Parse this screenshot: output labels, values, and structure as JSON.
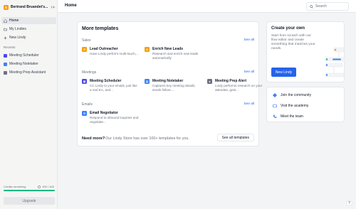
{
  "workspace": {
    "avatar_letter": "B",
    "name": "Bertrand Bruandet's..."
  },
  "topbar": {
    "title": "Home",
    "search_placeholder": "Search"
  },
  "nav": [
    {
      "label": "Home",
      "icon": "home-icon",
      "active": true
    },
    {
      "label": "My Lindies",
      "icon": "folder-icon",
      "active": false
    },
    {
      "label": "New Lindy",
      "icon": "plus-icon",
      "active": false
    }
  ],
  "recents": {
    "label": "Recents",
    "items": [
      {
        "label": "Meeting Scheduler",
        "color": "#4f46e5"
      },
      {
        "label": "Meeting Notetaker",
        "color": "#3b82f6"
      },
      {
        "label": "Meeting Prep Assistant",
        "color": "#6b7280"
      }
    ]
  },
  "credits": {
    "label": "Credits remaining",
    "value": "400 / 400",
    "fraction": 1.0,
    "upgrade_label": "Upgrade"
  },
  "templates": {
    "title": "More templates",
    "see_all_label": "See all",
    "categories": [
      {
        "name": "Sales",
        "items": [
          {
            "name": "Lead Outreacher",
            "desc": "Have Lindy perform multi-touch,...",
            "color": "#f59e0b"
          },
          {
            "name": "Enrich New Leads",
            "desc": "Research and enrich new leads automatically",
            "color": "#f59e0b"
          }
        ]
      },
      {
        "name": "Meetings",
        "items": [
          {
            "name": "Meeting Scheduler",
            "desc": "CC Lindy to your emails, just like a real EA, and...",
            "color": "#4f46e5"
          },
          {
            "name": "Meeting Notetaker",
            "desc": "Captures key meeting details, sends follow-...",
            "color": "#3b82f6"
          },
          {
            "name": "Meeting Prep Alert",
            "desc": "Lindy performs research on your attendee, gets...",
            "color": "#6b7280"
          }
        ]
      },
      {
        "name": "Emails",
        "items": [
          {
            "name": "Email Negotiator",
            "desc": "Respond to inbound inquiries and negotiate...",
            "color": "#3b82f6"
          }
        ]
      }
    ],
    "need_more_q": "Need more?",
    "need_more_text": "Our Lindy Store has over 100+ templates for you.",
    "see_all_templates_label": "See all templates"
  },
  "create": {
    "title": "Create your own",
    "desc": "Start from scratch with our flow editor and create something that matches your needs.",
    "button_label": "New Lindy"
  },
  "links": [
    {
      "label": "Join the community",
      "icon": "community-icon"
    },
    {
      "label": "Visit the academy",
      "icon": "academy-icon"
    },
    {
      "label": "Meet the team",
      "icon": "phone-icon"
    }
  ],
  "help_label": "?"
}
